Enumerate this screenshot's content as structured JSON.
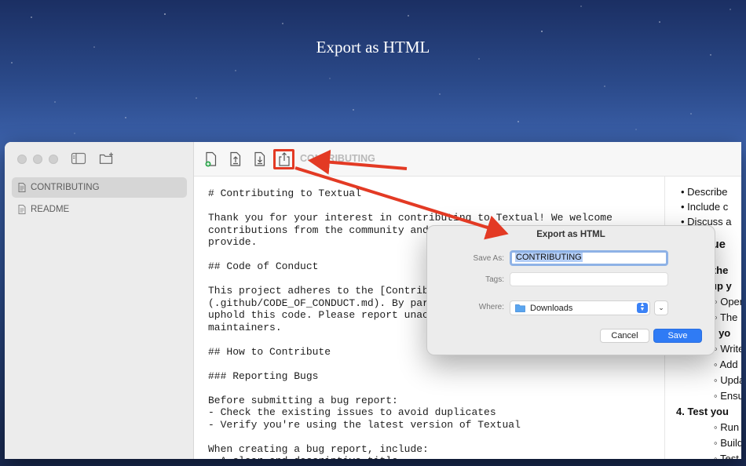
{
  "hero": {
    "title": "Export as HTML"
  },
  "sidebar": {
    "files": [
      {
        "name": "CONTRIBUTING",
        "selected": true
      },
      {
        "name": "README",
        "selected": false
      }
    ]
  },
  "toolbar": {
    "document_title": "CONTRIBUTING",
    "buttons": [
      "new-document-icon",
      "import-icon",
      "export-file-icon",
      "share-export-icon"
    ]
  },
  "editor": {
    "lines": [
      "# Contributing to Textual",
      "",
      "Thank you for your interest in contributing to Textual! We welcome",
      "contributions from the community and",
      "provide.",
      "",
      "## Code of Conduct",
      "",
      "This project adheres to the [Contrib",
      "(.github/CODE_OF_CONDUCT.md). By par",
      "uphold this code. Please report unac",
      "maintainers.",
      "",
      "## How to Contribute",
      "",
      "### Reporting Bugs",
      "",
      "Before submitting a bug report:",
      "- Check the existing issues to avoid duplicates",
      "- Verify you're using the latest version of Textual",
      "",
      "When creating a bug report, include:",
      "- A clear and descriptive title"
    ]
  },
  "preview": {
    "items": [
      {
        "text": "• Describe",
        "style": "normal"
      },
      {
        "text": "• Include c",
        "style": "normal"
      },
      {
        "text": "• Discuss a",
        "style": "normal"
      },
      {
        "text": "eque",
        "style": "heading"
      },
      {
        "text": "k the",
        "style": "bold"
      },
      {
        "text": "up y",
        "style": "bold"
      },
      {
        "text": "◦ Oper",
        "style": "normal"
      },
      {
        "text": "◦ The",
        "style": "normal"
      },
      {
        "text": "ke yo",
        "style": "bold"
      },
      {
        "text": "◦ Write",
        "style": "normal"
      },
      {
        "text": "◦ Add",
        "style": "normal"
      },
      {
        "text": "◦ Upda",
        "style": "normal"
      },
      {
        "text": "◦ Ensu",
        "style": "normal"
      },
      {
        "text": "4.  Test you",
        "style": "bold"
      },
      {
        "text": "◦ Run",
        "style": "normal"
      },
      {
        "text": "◦ Build",
        "style": "normal"
      },
      {
        "text": "◦ Test",
        "style": "normal"
      }
    ]
  },
  "dialog": {
    "title": "Export as HTML",
    "save_as_label": "Save As:",
    "save_as_value": "CONTRIBUTING",
    "tags_label": "Tags:",
    "tags_value": "",
    "where_label": "Where:",
    "where_value": "Downloads",
    "expand_label": "⌄",
    "cancel_label": "Cancel",
    "save_label": "Save"
  },
  "colors": {
    "annotation": "#e33a24",
    "accent": "#2f7bf5"
  }
}
